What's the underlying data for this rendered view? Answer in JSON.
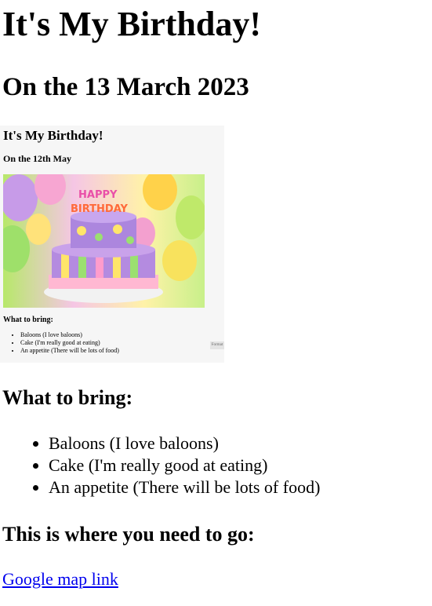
{
  "heading": "It's My Birthday!",
  "date_heading": "On the 13 March 2023",
  "screenshot": {
    "title": "It's My Birthday!",
    "subtitle": "On the 12th May",
    "image_alt": "birthday cake",
    "bring_heading": "What to bring:",
    "items": [
      "Baloons (I love baloons)",
      "Cake (I'm really good at eating)",
      "An appetite (There will be lots of food)"
    ],
    "button_label": "Format"
  },
  "bring_heading": "What to bring:",
  "items": [
    "Baloons (I love baloons)",
    "Cake (I'm really good at eating)",
    "An appetite (There will be lots of food)"
  ],
  "where_heading": "This is where you need to go:",
  "map_link": "Google map link",
  "colors": {
    "link": "#0000ee",
    "text": "#000000"
  }
}
